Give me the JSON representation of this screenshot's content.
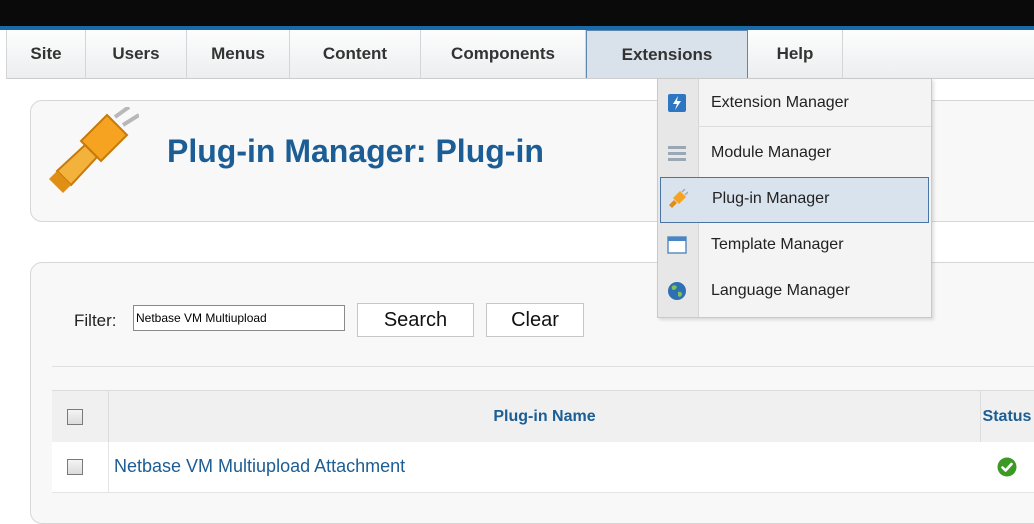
{
  "menu": {
    "items": [
      {
        "label": "Site"
      },
      {
        "label": "Users"
      },
      {
        "label": "Menus"
      },
      {
        "label": "Content"
      },
      {
        "label": "Components"
      },
      {
        "label": "Extensions"
      },
      {
        "label": "Help"
      }
    ],
    "active": "Extensions"
  },
  "extensions_dropdown": {
    "items": [
      {
        "label": "Extension Manager",
        "icon": "extension-manager-icon"
      },
      {
        "label": "Module Manager",
        "icon": "module-manager-icon"
      },
      {
        "label": "Plug-in Manager",
        "icon": "plug-icon"
      },
      {
        "label": "Template Manager",
        "icon": "template-manager-icon"
      },
      {
        "label": "Language Manager",
        "icon": "globe-icon"
      }
    ],
    "highlighted": "Plug-in Manager"
  },
  "page": {
    "title": "Plug-in Manager: Plug-in",
    "icon": "plug-icon"
  },
  "filter": {
    "label": "Filter:",
    "value": "Netbase VM Multiupload",
    "search_label": "Search",
    "clear_label": "Clear"
  },
  "table": {
    "columns": {
      "name": "Plug-in Name",
      "status": "Status"
    },
    "rows": [
      {
        "name": "Netbase VM Multiupload Attachment",
        "status": "enabled",
        "status_icon": "check-circle-icon"
      }
    ]
  },
  "colors": {
    "brand_blue": "#1b5d94",
    "status_green": "#3c9a24",
    "active_menu_bg": "#d9e1ea",
    "highlight_border": "#4a74a3"
  }
}
